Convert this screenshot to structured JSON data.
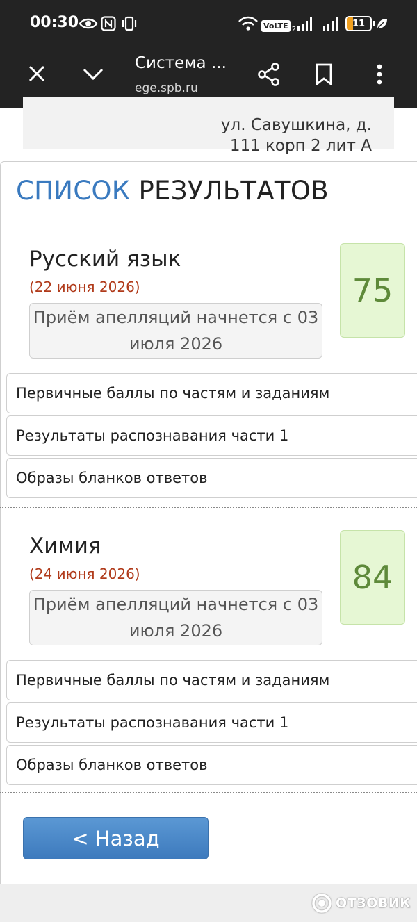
{
  "status_bar": {
    "time": "00:30",
    "volte_label": "VoLTE",
    "volte_sub": "2",
    "battery_level": "11",
    "icons": [
      "eye-icon",
      "nfc-icon",
      "vibrate-icon",
      "wifi-icon",
      "signal-icon",
      "signal-icon",
      "battery-icon",
      "leaf-icon"
    ]
  },
  "browser": {
    "title": "Система ...",
    "url": "ege.spb.ru"
  },
  "address": {
    "text": "ул. Савушкина, д.\n111 корп 2 лит А"
  },
  "results": {
    "title_part1": "СПИСОК",
    "title_part2": "РЕЗУЛЬТАТОВ"
  },
  "subjects": [
    {
      "name": "Русский язык",
      "date": "(22 июня 2026)",
      "appeal_line1": "Приём апелляций начнется с 03",
      "appeal_line2": "июля 2026",
      "score": "75",
      "links": [
        "Первичные баллы по частям и заданиям",
        "Результаты распознавания части 1",
        "Образы бланков ответов"
      ]
    },
    {
      "name": "Химия",
      "date": "(24 июня 2026)",
      "appeal_line1": "Приём апелляций начнется с 03",
      "appeal_line2": "июля 2026",
      "score": "84",
      "links": [
        "Первичные баллы по частям и заданиям",
        "Результаты распознавания части 1",
        "Образы бланков ответов"
      ]
    }
  ],
  "back_button": {
    "label": "< Назад"
  },
  "watermark": {
    "text": "ОТЗОВИК"
  },
  "colors": {
    "accent_blue": "#3a7abf",
    "date_red": "#b03a1a",
    "score_bg": "#e6f7d4",
    "score_text": "#5e8a3a"
  }
}
